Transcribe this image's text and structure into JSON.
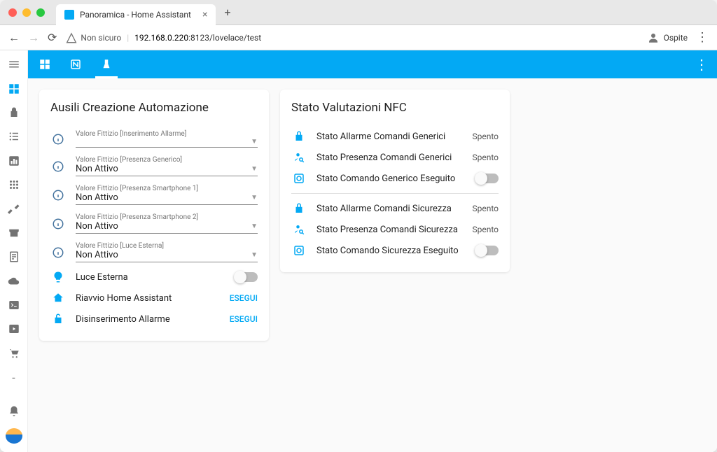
{
  "browser": {
    "tab_title": "Panoramica - Home Assistant",
    "insecure_label": "Non sicuro",
    "url_host": "192.168.0.220",
    "url_path": ":8123/lovelace/test",
    "profile_label": "Ospite"
  },
  "card1": {
    "title": "Ausili Creazione Automazione",
    "selects": [
      {
        "label": "Valore Fittizio [Inserimento Allarme]",
        "value": ""
      },
      {
        "label": "Valore Fittizio [Presenza Generico]",
        "value": "Non Attivo"
      },
      {
        "label": "Valore Fittizio [Presenza Smartphone 1]",
        "value": "Non Attivo"
      },
      {
        "label": "Valore Fittizio [Presenza Smartphone 2]",
        "value": "Non Attivo"
      },
      {
        "label": "Valore Fittizio [Luce Esterna]",
        "value": "Non Attivo"
      }
    ],
    "light_row": "Luce Esterna",
    "restart_row": "Riavvio Home Assistant",
    "disarm_row": "Disinserimento Allarme",
    "action_label": "ESEGUI"
  },
  "card2": {
    "title": "Stato Valutazioni NFC",
    "rows": [
      {
        "icon": "lock",
        "label": "Stato Allarme Comandi Generici",
        "state": "Spento"
      },
      {
        "icon": "person",
        "label": "Stato Presenza Comandi Generici",
        "state": "Spento"
      },
      {
        "icon": "cmd",
        "label": "Stato Comando Generico Eseguito",
        "state": "toggle"
      },
      {
        "icon": "lock",
        "label": "Stato Allarme Comandi Sicurezza",
        "state": "Spento"
      },
      {
        "icon": "person",
        "label": "Stato Presenza Comandi Sicurezza",
        "state": "Spento"
      },
      {
        "icon": "cmd",
        "label": "Stato Comando Sicurezza Eseguito",
        "state": "toggle"
      }
    ]
  }
}
